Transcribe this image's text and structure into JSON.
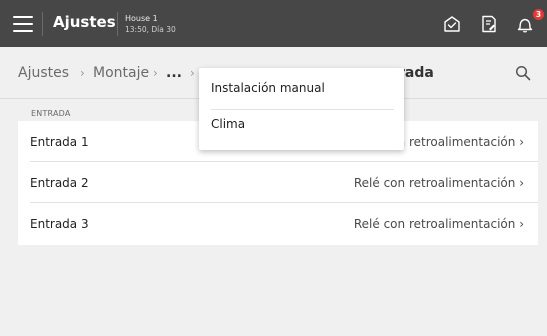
{
  "header": {
    "title": "Ajustes",
    "house_name": "House 1",
    "house_time": "13:50, Día 30",
    "notification_count": "3"
  },
  "breadcrumb": {
    "item1": "Ajustes",
    "item2": "Montaje",
    "item3": "...",
    "current_partial": "rada",
    "separator": "›"
  },
  "section": {
    "title": "ENTRADA"
  },
  "rows": [
    {
      "label": "Entrada 1",
      "value": "Relé con retroalimentación"
    },
    {
      "label": "Entrada 2",
      "value": "Relé con retroalimentación"
    },
    {
      "label": "Entrada 3",
      "value": "Relé con retroalimentación"
    }
  ],
  "row_chevron": "›",
  "popup": {
    "items": [
      {
        "label": "Instalación manual"
      },
      {
        "label": "Clima"
      }
    ]
  },
  "colors": {
    "topbar": "#474747",
    "background": "#f0f0f0",
    "badge": "#e53935"
  },
  "icons": {
    "menu": "hamburger-menu-icon",
    "home": "house-check-icon",
    "document": "document-edit-icon",
    "bell": "bell-icon",
    "search": "search-icon",
    "chevron": "chevron-right-icon"
  }
}
